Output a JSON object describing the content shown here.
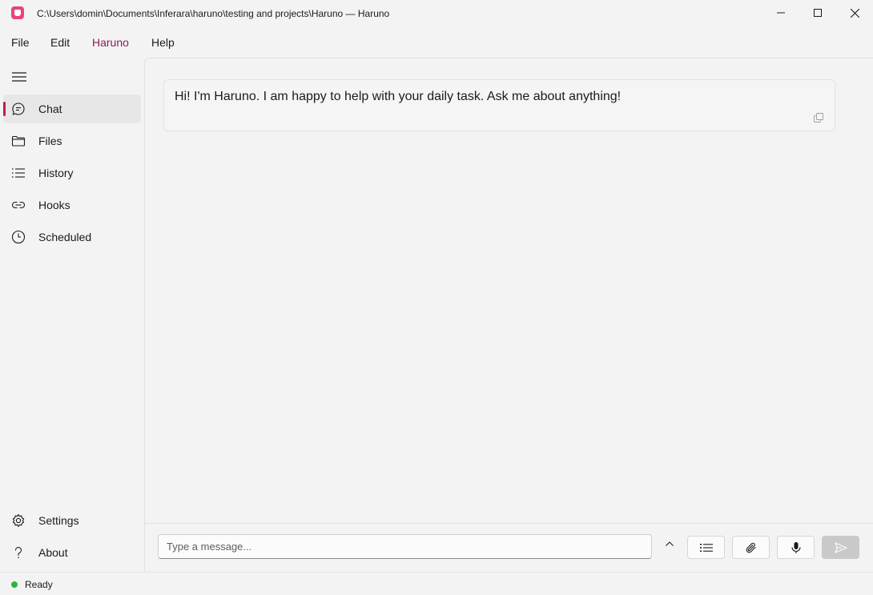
{
  "window": {
    "title": "C:\\Users\\domin\\Documents\\Inferara\\haruno\\testing and projects\\Haruno — Haruno",
    "app_icon": "haruno-app-icon",
    "controls": [
      "minimize-icon",
      "maximize-icon",
      "close-icon"
    ]
  },
  "menu": {
    "items": [
      {
        "label": "File"
      },
      {
        "label": "Edit"
      },
      {
        "label": "Haruno",
        "active": true
      },
      {
        "label": "Help"
      }
    ]
  },
  "sidebar": {
    "toggle_icon": "hamburger-icon",
    "items": [
      {
        "label": "Chat",
        "icon": "chat-bubble-icon",
        "selected": true
      },
      {
        "label": "Files",
        "icon": "folder-icon"
      },
      {
        "label": "History",
        "icon": "list-icon"
      },
      {
        "label": "Hooks",
        "icon": "link-icon"
      },
      {
        "label": "Scheduled",
        "icon": "clock-icon"
      }
    ],
    "bottom_items": [
      {
        "label": "Settings",
        "icon": "gear-icon"
      },
      {
        "label": "About",
        "icon": "question-mark-icon"
      }
    ]
  },
  "chat": {
    "messages": [
      {
        "text": "Hi! I'm Haruno. I am happy to help with your daily task. Ask me about anything!",
        "action_icon": "copy-icon"
      }
    ]
  },
  "composer": {
    "placeholder": "Type a message...",
    "value": "",
    "expand_icon": "chevron-up-icon",
    "buttons": [
      "list-icon",
      "paperclip-icon",
      "microphone-icon",
      "send-icon"
    ]
  },
  "status": {
    "text": "Ready",
    "indicator_color": "#2fb344"
  },
  "colors": {
    "accent": "#c2185b",
    "active_menu": "#8a1d55",
    "background": "#f3f3f3"
  }
}
